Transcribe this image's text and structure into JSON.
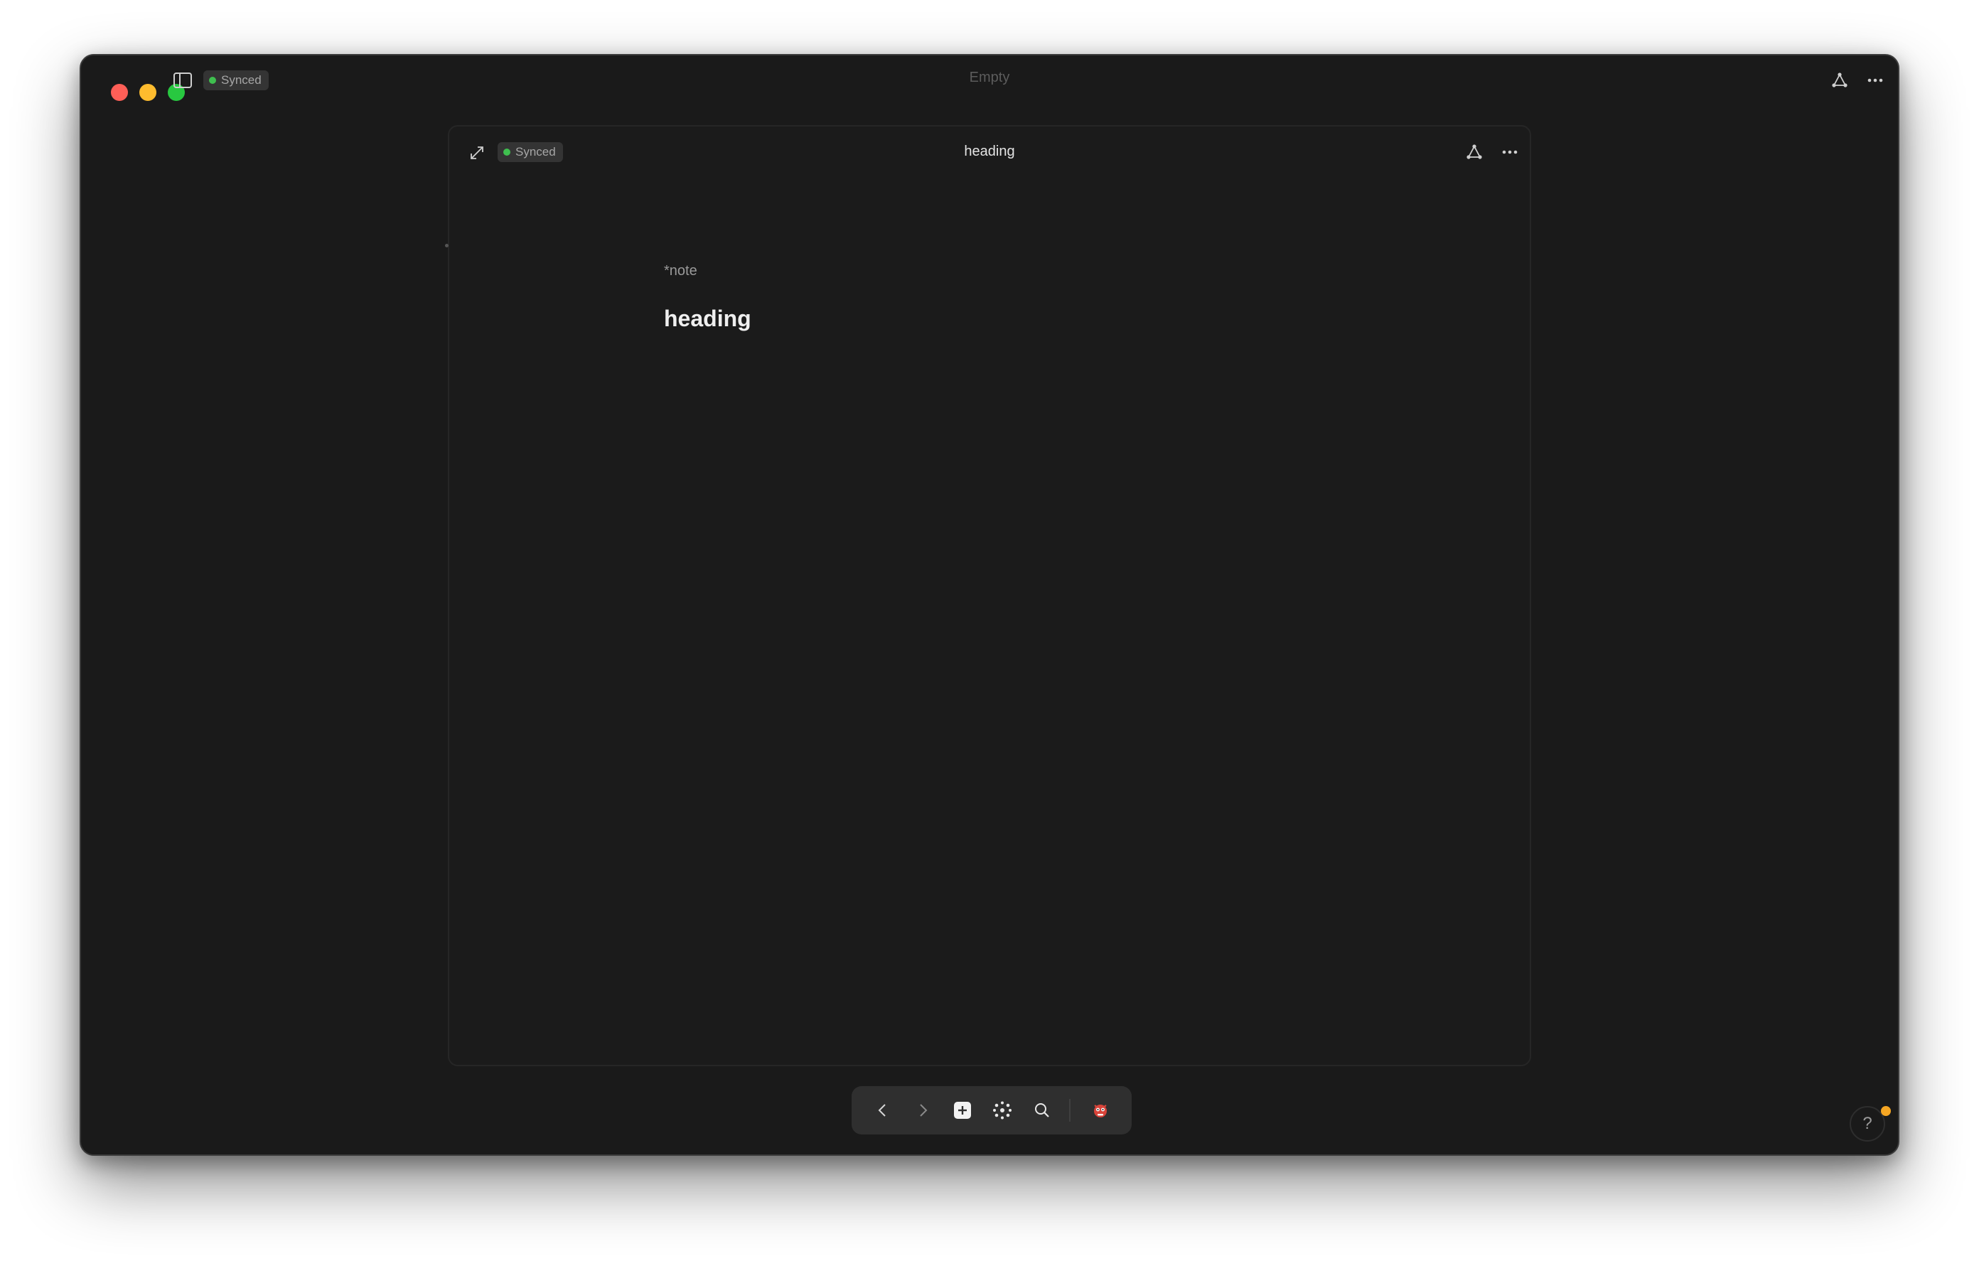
{
  "window": {
    "title": "Empty",
    "sync_status": "Synced",
    "icons": [
      "sidebar-toggle-icon",
      "graph-icon",
      "more-icon"
    ]
  },
  "note": {
    "title": "heading",
    "sync_status": "Synced",
    "tag": "*note",
    "heading": "heading",
    "icons": [
      "expand-icon",
      "graph-icon",
      "more-icon"
    ]
  },
  "toolbar": {
    "items": [
      "back-icon",
      "forward-icon",
      "new-note-icon",
      "graph-view-icon",
      "search-icon",
      "profile-icon"
    ]
  },
  "help": {
    "label": "?",
    "notification_color": "#f5a623"
  },
  "colors": {
    "background": "#1a1a1a",
    "sync_dot": "#3fbf4f",
    "close": "#ff5f57",
    "minimize": "#febc2e",
    "zoom": "#28c840"
  }
}
